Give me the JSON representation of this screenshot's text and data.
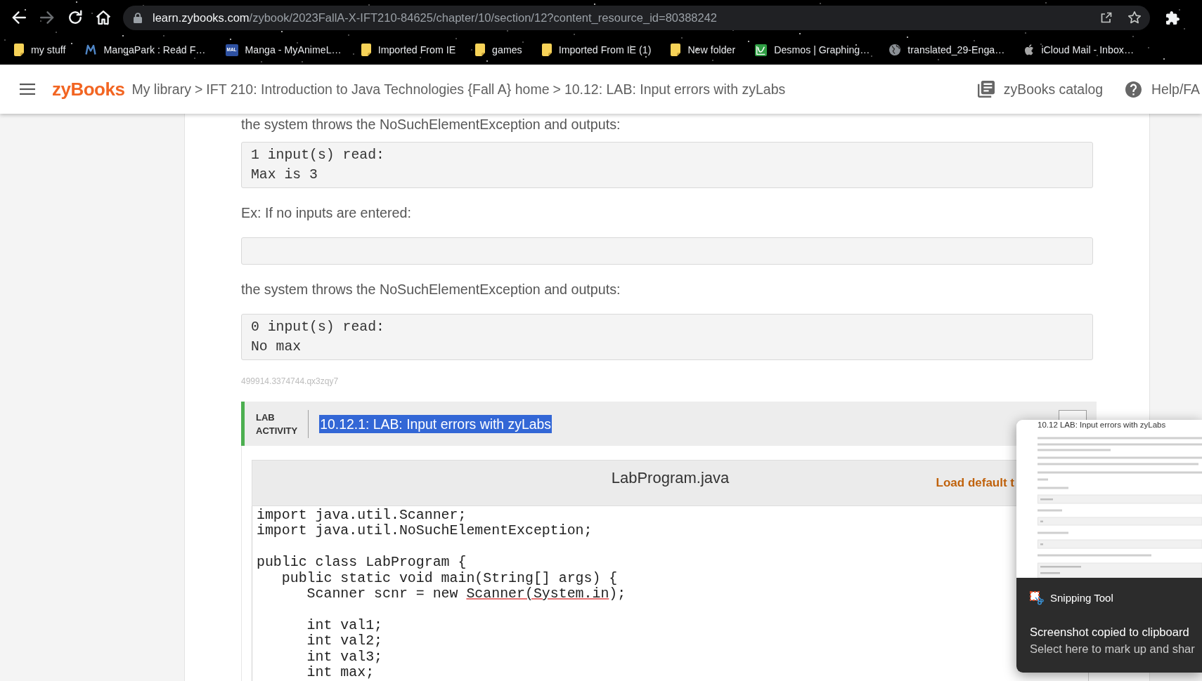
{
  "browser": {
    "nav_buttons": [
      {
        "kind": "back",
        "disabled": false
      },
      {
        "kind": "forward",
        "disabled": true
      },
      {
        "kind": "reload",
        "disabled": false
      },
      {
        "kind": "home",
        "disabled": false
      }
    ],
    "address": {
      "url_host": "learn.zybooks.com",
      "url_path": "/zybook/2023FallA-X-IFT210-84625/chapter/10/section/12?content_resource_id=80388242"
    },
    "bookmarks": [
      {
        "kind": "folder",
        "label": "my stuff"
      },
      {
        "kind": "zigzag",
        "label": "MangaPark : Read F…"
      },
      {
        "kind": "badge",
        "icon_text": "MAL",
        "label": "Manga - MyAnimeL…"
      },
      {
        "kind": "folder",
        "label": "Imported From IE"
      },
      {
        "kind": "folder",
        "label": "games"
      },
      {
        "kind": "folder",
        "label": "Imported From IE (1)"
      },
      {
        "kind": "folder",
        "label": "New folder"
      },
      {
        "kind": "graph",
        "label": "Desmos | Graphing…"
      },
      {
        "kind": "globe",
        "label": "translated_29-Enga…"
      },
      {
        "kind": "apple",
        "label": "iCloud Mail - Inbox…"
      }
    ]
  },
  "header": {
    "logo": "zyBooks",
    "breadcrumbs": [
      {
        "kind": "link",
        "text": "My library"
      },
      {
        "kind": "separator",
        "text": ">"
      },
      {
        "kind": "link",
        "text": "IFT 210: Introduction to Java Technologies {Fall A} home"
      },
      {
        "kind": "separator",
        "text": ">"
      },
      {
        "kind": "link",
        "text": "10.12: LAB: Input errors with zyLabs"
      }
    ],
    "catalog": "zyBooks catalog",
    "help": "Help/FA"
  },
  "content": {
    "blocks": [
      {
        "kind": "paragraph",
        "text": "the system throws the NoSuchElementException and outputs:"
      },
      {
        "kind": "output",
        "lines": [
          "1 input(s) read:",
          "Max is 3"
        ]
      },
      {
        "kind": "paragraph",
        "text": "Ex: If no inputs are entered:"
      },
      {
        "kind": "output"
      },
      {
        "kind": "paragraph",
        "text": "the system throws the NoSuchElementException and outputs:"
      },
      {
        "kind": "output",
        "lines": [
          "0 input(s) read:",
          "No max"
        ]
      },
      {
        "kind": "id",
        "text": "499914.3374744.qx3zqy7"
      }
    ]
  },
  "lab": {
    "label_lines": [
      "LAB",
      "ACTIVITY"
    ],
    "title": "10.12.1: LAB: Input errors with zyLabs",
    "title_selected": true
  },
  "editor": {
    "filename": "LabProgram.java",
    "load_default": "Load default t",
    "lines": [
      {
        "kind": "code",
        "segments": [
          {
            "text": "import java.util.Scanner;",
            "error": false
          }
        ]
      },
      {
        "kind": "code",
        "segments": [
          {
            "text": "import java.util.NoSuchElementException;",
            "error": false
          }
        ]
      },
      {
        "kind": "blank"
      },
      {
        "kind": "code",
        "segments": [
          {
            "text": "public class LabProgram {",
            "error": false
          }
        ]
      },
      {
        "kind": "code",
        "segments": [
          {
            "text": "   public static void main(String[] args) {",
            "error": false
          }
        ]
      },
      {
        "kind": "code",
        "segments": [
          {
            "text": "      Scanner scnr = new ",
            "error": false
          },
          {
            "text": "Scanner(System.in",
            "error": true
          },
          {
            "text": ");",
            "error": false
          }
        ]
      },
      {
        "kind": "blank"
      },
      {
        "kind": "code",
        "segments": [
          {
            "text": "      int val1;",
            "error": false
          }
        ]
      },
      {
        "kind": "code",
        "segments": [
          {
            "text": "      int val2;",
            "error": false
          }
        ]
      },
      {
        "kind": "code",
        "segments": [
          {
            "text": "      int val3;",
            "error": false
          }
        ]
      },
      {
        "kind": "code",
        "segments": [
          {
            "text": "      int max;",
            "error": false
          }
        ]
      }
    ]
  },
  "notification": {
    "thumbnail_title": "10.12 LAB: Input errors with zyLabs",
    "app": "Snipping Tool",
    "message": "Screenshot copied to clipboard",
    "hint": "Select here to mark up and shar"
  }
}
